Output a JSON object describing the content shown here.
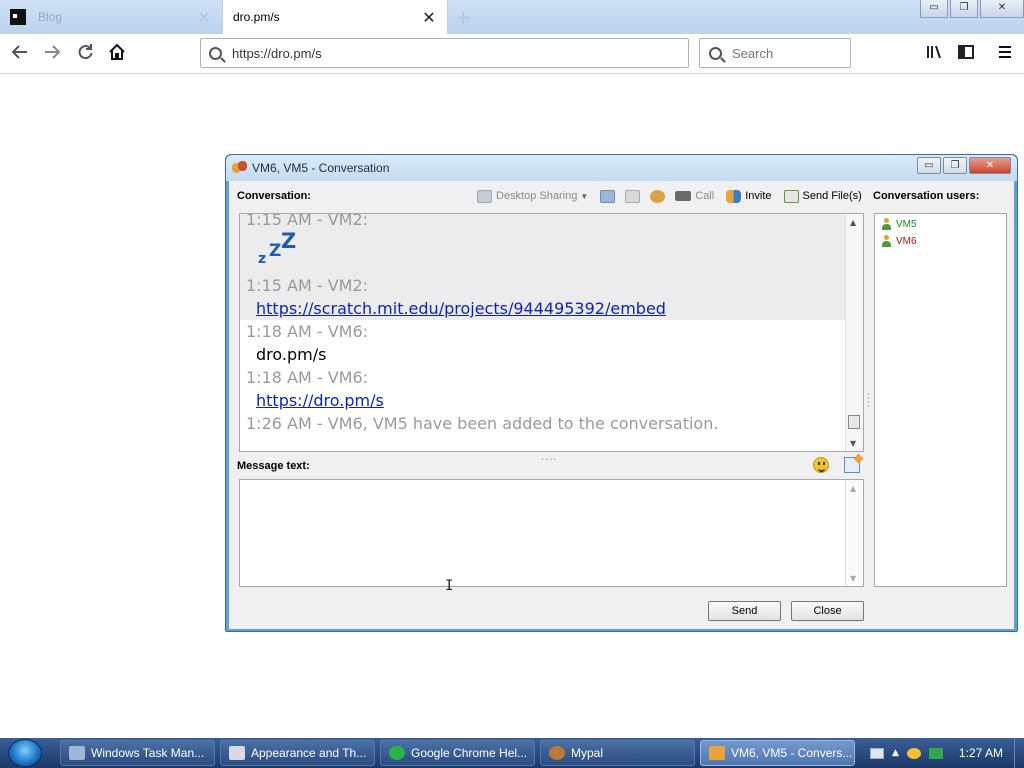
{
  "browser": {
    "tabs": [
      {
        "title": "Blog",
        "active": false
      },
      {
        "title": "dro.pm/s",
        "active": true
      }
    ],
    "new_tab_symbol": "+",
    "url": "https://dro.pm/s",
    "search_placeholder": "Search",
    "window_controls": {
      "minimize": "▭",
      "restore": "❐",
      "close": "✕"
    },
    "tab_close_symbol": "✕"
  },
  "conversation": {
    "title": "VM6, VM5 - Conversation",
    "conversation_label": "Conversation:",
    "users_label": "Conversation users:",
    "message_label": "Message text:",
    "toolbar": {
      "desktop_sharing": "Desktop Sharing",
      "call": "Call",
      "invite": "Invite",
      "send_files": "Send File(s)"
    },
    "history": [
      {
        "timestamp": "1:15 AM - VM2:",
        "partial": true
      },
      {
        "content_type": "zzz-emoticon",
        "zzz": [
          "z",
          "Z",
          "Z"
        ]
      },
      {
        "timestamp": "1:15 AM - VM2:",
        "text": "https://scratch.mit.edu/projects/944495392/embed",
        "link": true
      },
      {
        "timestamp": "1:18 AM - VM6:",
        "text": "dro.pm/s",
        "link": false
      },
      {
        "timestamp": "1:18 AM - VM6:",
        "text": "https://dro.pm/s",
        "link": true
      },
      {
        "timestamp": "1:26 AM - VM6, VM5 have been added to the conversation."
      }
    ],
    "users": [
      {
        "name": "VM5",
        "color": "#1a8a1a"
      },
      {
        "name": "VM6",
        "color": "#b01010"
      }
    ],
    "message_input_value": "",
    "buttons": {
      "send": "Send",
      "close": "Close"
    }
  },
  "taskbar": {
    "items": [
      {
        "label": "Windows Task Man...",
        "icon_color": "#9fb6d6",
        "active": false
      },
      {
        "label": "Appearance and Th...",
        "icon_color": "#d8d8e8",
        "active": false
      },
      {
        "label": "Google Chrome Hel...",
        "icon_color": "#2bb24c",
        "active": false
      },
      {
        "label": "Mypal",
        "icon_color": "#b8793a",
        "active": false
      },
      {
        "label": "VM6, VM5 - Convers...",
        "icon_color": "#e8a43a",
        "active": true
      }
    ],
    "clock": "1:27 AM"
  }
}
